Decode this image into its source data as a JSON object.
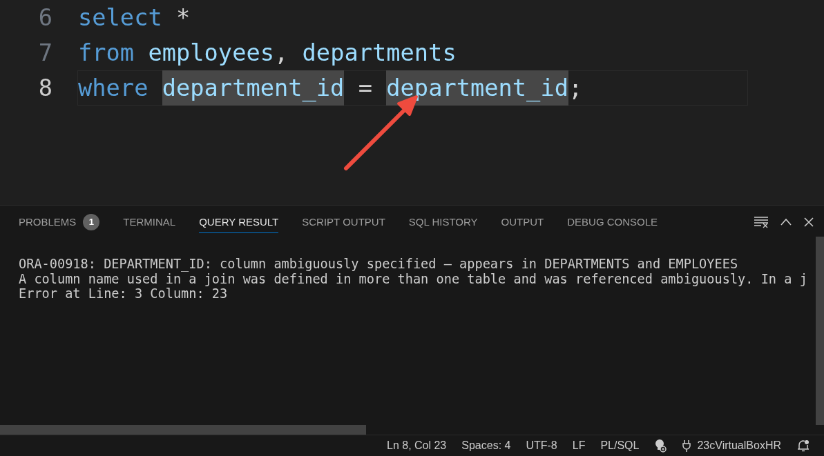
{
  "editor": {
    "lines": [
      {
        "number": "6",
        "current": false,
        "tokens": [
          {
            "kind": "keyword",
            "text": "select",
            "highlighted": false
          },
          {
            "kind": "operator",
            "text": "*",
            "highlighted": false
          }
        ]
      },
      {
        "number": "7",
        "current": false,
        "tokens": [
          {
            "kind": "keyword",
            "text": "from",
            "highlighted": false
          },
          {
            "kind": "identifier",
            "text": "employees",
            "highlighted": false
          },
          {
            "kind": "punctuation",
            "text": ",",
            "highlighted": false
          },
          {
            "kind": "identifier",
            "text": "departments",
            "highlighted": false
          }
        ]
      },
      {
        "number": "8",
        "current": true,
        "tokens": [
          {
            "kind": "keyword",
            "text": "where",
            "highlighted": false
          },
          {
            "kind": "identifier",
            "text": "department_id",
            "highlighted": true
          },
          {
            "kind": "operator",
            "text": "=",
            "highlighted": false
          },
          {
            "kind": "identifier",
            "text": "department_id",
            "highlighted": true
          },
          {
            "kind": "punctuation",
            "text": ";",
            "highlighted": false
          }
        ]
      }
    ]
  },
  "panel": {
    "tabs": [
      {
        "label": "PROBLEMS",
        "badge": "1",
        "selected": false
      },
      {
        "label": "TERMINAL",
        "selected": false
      },
      {
        "label": "QUERY RESULT",
        "selected": true
      },
      {
        "label": "SCRIPT OUTPUT",
        "selected": false
      },
      {
        "label": "SQL HISTORY",
        "selected": false
      },
      {
        "label": "OUTPUT",
        "selected": false
      },
      {
        "label": "DEBUG CONSOLE",
        "selected": false
      }
    ],
    "output": [
      "ORA-00918: DEPARTMENT_ID: column ambiguously specified – appears in DEPARTMENTS and EMPLOYEES",
      "A column name used in a join was defined in more than one table and was referenced ambiguously. In a j",
      "Error at Line: 3 Column: 23"
    ]
  },
  "status_bar": {
    "cursor": "Ln 8, Col 23",
    "indent": "Spaces: 4",
    "encoding": "UTF-8",
    "eol": "LF",
    "language": "PL/SQL",
    "connection": "23cVirtualBoxHR"
  }
}
